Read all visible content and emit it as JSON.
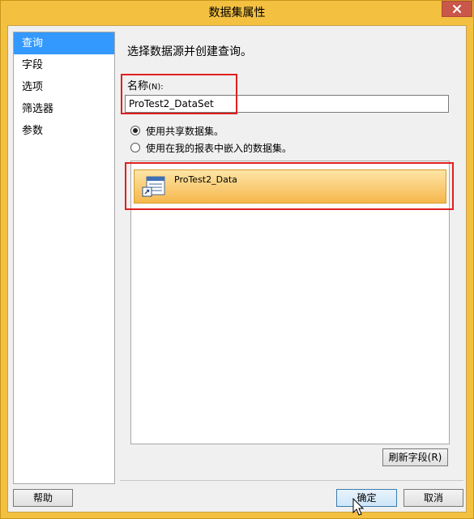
{
  "window": {
    "title": "数据集属性"
  },
  "nav": {
    "items": [
      "查询",
      "字段",
      "选项",
      "筛选器",
      "参数"
    ],
    "selected_index": 0
  },
  "main": {
    "heading": "选择数据源并创建查询。",
    "name_label": "名称",
    "name_accel": "(N):",
    "name_value": "ProTest2_DataSet",
    "radio_shared": "使用共享数据集。",
    "radio_embedded": "使用在我的报表中嵌入的数据集。",
    "dataset_items": [
      "ProTest2_Data"
    ],
    "refresh_button": "刷新字段(R)"
  },
  "footer": {
    "help": "帮助",
    "ok": "确定",
    "cancel": "取消"
  }
}
